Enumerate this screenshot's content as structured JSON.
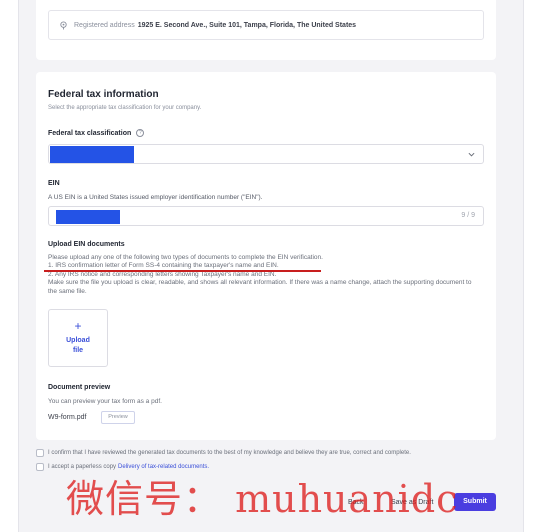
{
  "address": {
    "prefix": "Registered address",
    "value": "1925 E. Second Ave., Suite 101, Tampa, Florida, The United States"
  },
  "federal_tax": {
    "title": "Federal tax information",
    "subtitle": "Select the appropriate tax classification for your company.",
    "classification_label": "Federal tax classification"
  },
  "ein": {
    "label": "EIN",
    "help": "A US EIN is a United States issued employer identification number (\"EIN\").",
    "counter": "9 / 9"
  },
  "upload": {
    "title": "Upload EIN documents",
    "line1": "Please upload any one of the following two types of documents to complete the EIN verification.",
    "line2": "1. IRS confirmation letter of Form SS-4 containing the taxpayer's name and EIN.",
    "line3": "2. Any IRS notice and corresponding letters showing Taxpayer's name and EIN.",
    "line4": "Make sure the file you upload is clear, readable, and shows all relevant information. If there was a name change, attach the supporting document to the same file.",
    "button_line1": "Upload",
    "button_line2": "file"
  },
  "preview": {
    "title": "Document preview",
    "subtitle": "You can preview your tax form as a pdf.",
    "filename": "W9-form.pdf",
    "button": "Preview"
  },
  "consent": {
    "confirm": "I confirm that I have reviewed the generated tax documents to the best of my knowledge and believe they are true, correct and complete.",
    "accept_prefix": "I accept a paperless copy",
    "accept_link": "Delivery of tax-related documents."
  },
  "footer": {
    "back": "Back",
    "save_draft": "Save as Draft",
    "submit": "Submit"
  },
  "watermark": "微信号： muhuanidc",
  "colors": {
    "accent": "#4a3de0",
    "redaction": "#2453e6",
    "annotation": "#c81e1e"
  }
}
